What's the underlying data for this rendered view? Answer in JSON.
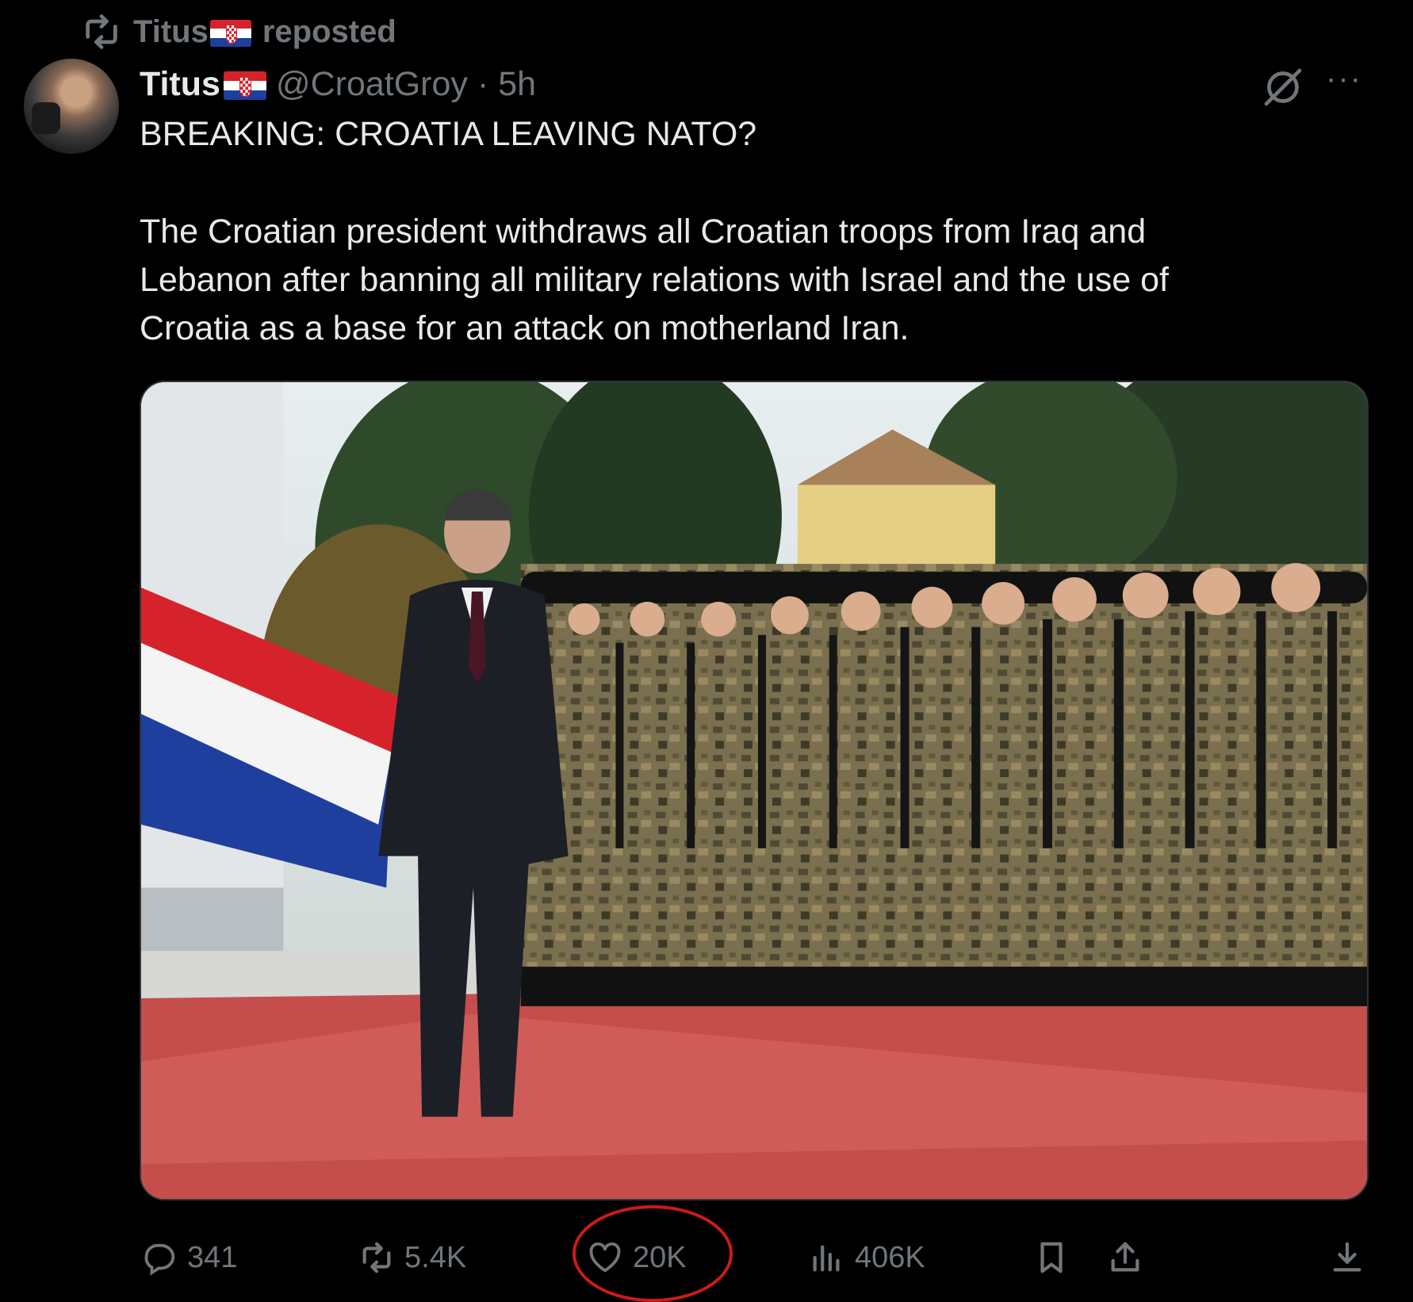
{
  "repost": {
    "user": "Titus",
    "label": "reposted"
  },
  "tweet": {
    "display_name": "Titus",
    "handle": "@CroatGroy",
    "separator": "·",
    "time": "5h",
    "headline": "BREAKING: CROATIA LEAVING NATO?",
    "body": "The Croatian president withdraws all Croatian troops from Iraq and Lebanon after banning all military relations with Israel and the use of Croatia as a base for an attack on motherland Iran.",
    "more": "···"
  },
  "actions": {
    "replies": "341",
    "reposts": "5.4K",
    "likes": "20K",
    "views": "406K"
  },
  "colors": {
    "background": "#000000",
    "text": "#e7e9ea",
    "muted": "#71767b",
    "annotation": "#cc1a1a"
  },
  "icons": [
    "repost-icon",
    "croatian-flag-icon",
    "grok-icon",
    "more-icon",
    "reply-icon",
    "like-icon",
    "views-icon",
    "bookmark-icon",
    "share-icon",
    "download-icon"
  ]
}
